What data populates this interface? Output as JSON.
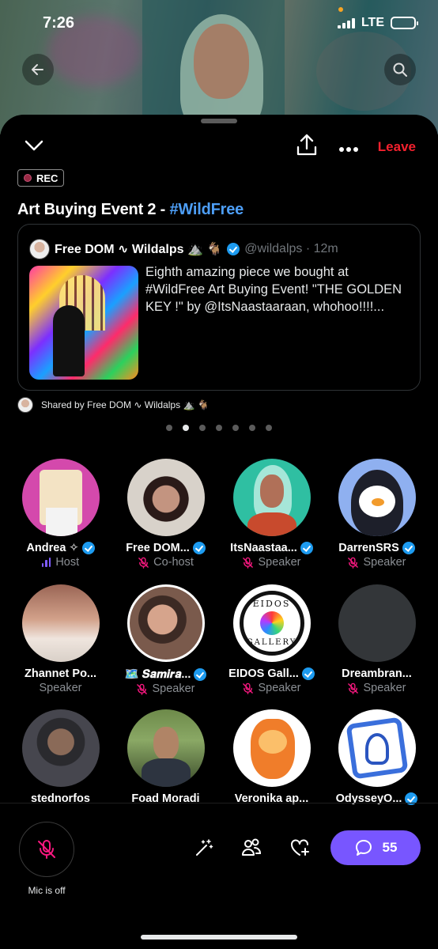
{
  "status": {
    "time": "7:26",
    "network": "LTE"
  },
  "header": {
    "leave_label": "Leave"
  },
  "recording": {
    "label": "REC"
  },
  "space": {
    "title_prefix": "Art Buying Event 2 - ",
    "title_tag": "#WildFree"
  },
  "tweet": {
    "author_name": "Free DOM ∿ Wildalps ⛰️ 🐐",
    "handle_time": "@wildalps · 12m",
    "text": "Eighth amazing piece we bought at #WildFree Art Buying Event! \"THE GOLDEN KEY !\" by @ItsNaastaaraan, whohoo!!!!..."
  },
  "shared_by": "Shared by Free DOM ∿ Wildalps ⛰️ 🐐",
  "carousel": {
    "count": 7,
    "active_index": 1
  },
  "speakers": [
    {
      "name": "Andrea ✧",
      "verified": true,
      "role": "Host",
      "role_icon": "host-bars-icon"
    },
    {
      "name": "Free DOM...",
      "verified": true,
      "role": "Co-host",
      "role_icon": "mic-off-icon"
    },
    {
      "name": "ItsNaastaa...",
      "verified": true,
      "role": "Speaker",
      "role_icon": "mic-off-icon"
    },
    {
      "name": "DarrenSRS",
      "verified": true,
      "role": "Speaker",
      "role_icon": "mic-off-icon"
    },
    {
      "name": "Zhannet Po...",
      "verified": false,
      "role": "Speaker",
      "role_icon": "none"
    },
    {
      "name": "🗺️ 𝑺𝒂𝒎𝒊𝒓𝒂...",
      "verified": true,
      "role": "Speaker",
      "role_icon": "mic-off-icon"
    },
    {
      "name": "EIDOS Gall...",
      "verified": true,
      "role": "Speaker",
      "role_icon": "mic-off-icon"
    },
    {
      "name": "Dreambran...",
      "verified": false,
      "role": "Speaker",
      "role_icon": "mic-off-icon"
    },
    {
      "name": "stednorfos",
      "verified": false,
      "role": "",
      "role_icon": "none"
    },
    {
      "name": "Foad Moradi",
      "verified": false,
      "role": "",
      "role_icon": "none"
    },
    {
      "name": "Veronika ap...",
      "verified": false,
      "role": "",
      "role_icon": "none"
    },
    {
      "name": "OdysseyO...",
      "verified": true,
      "role": "",
      "role_icon": "none"
    }
  ],
  "eidos_logo": {
    "top": "EIDOS",
    "bottom": "GALLERY"
  },
  "bottom_bar": {
    "mic_label": "Mic is off",
    "comments_count": "55"
  },
  "colors": {
    "accent": "#7856ff",
    "leave": "#f4212e",
    "link": "#4d9ef6",
    "verified": "#1d9bf0",
    "mic_off": "#f91880"
  }
}
